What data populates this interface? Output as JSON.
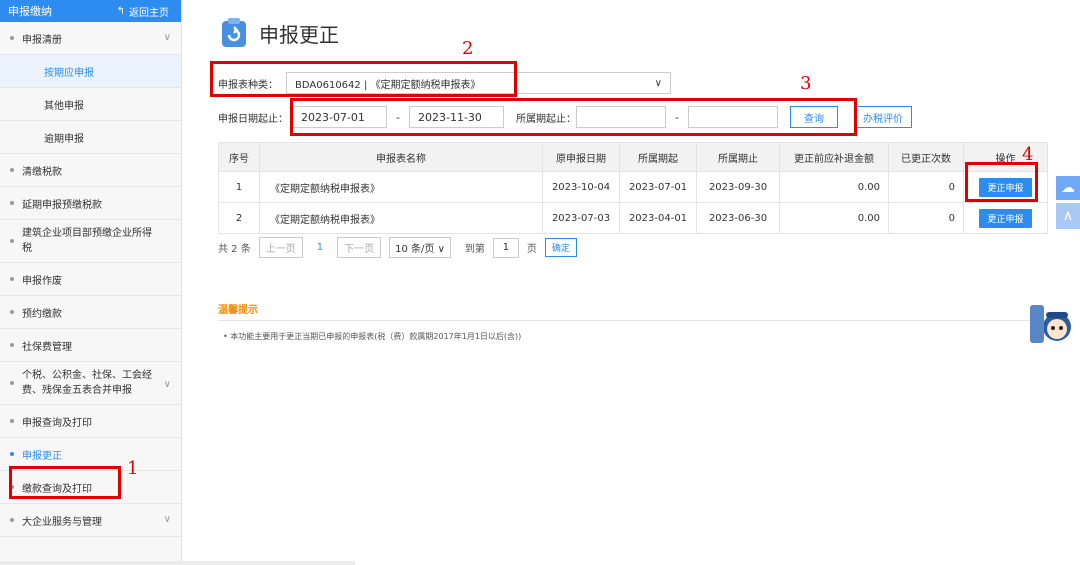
{
  "sidebar": {
    "header_title": "申报缴纳",
    "back_label": "返回主页",
    "items": [
      {
        "label": "申报清册"
      },
      {
        "label": "按期应申报"
      },
      {
        "label": "其他申报"
      },
      {
        "label": "逾期申报"
      },
      {
        "label": "清缴税款"
      },
      {
        "label": "延期申报预缴税款"
      },
      {
        "label": "建筑企业项目部预缴企业所得税"
      },
      {
        "label": "申报作废"
      },
      {
        "label": "预约缴款"
      },
      {
        "label": "社保费管理"
      },
      {
        "label": "个税、公积金、社保、工会经费、残保金五表合并申报"
      },
      {
        "label": "申报查询及打印"
      },
      {
        "label": "申报更正"
      },
      {
        "label": "缴款查询及打印"
      },
      {
        "label": "大企业服务与管理"
      }
    ]
  },
  "main": {
    "title": "申报更正",
    "form_type_label": "申报表种类：",
    "form_type_value": "BDA0610642 | 《定期定额纳税申报表》",
    "date_label": "申报日期起止：",
    "date_from": "2023-07-01",
    "date_to": "2023-11-30",
    "period_label": "所属期起止：",
    "period_from": "",
    "period_to": "",
    "dash": "-",
    "query_label": "查询",
    "evaluate_label": "办税评价"
  },
  "table": {
    "headers": [
      "序号",
      "申报表名称",
      "原申报日期",
      "所属期起",
      "所属期止",
      "更正前应补退金额",
      "已更正次数",
      "操作"
    ],
    "rows": [
      {
        "no": "1",
        "name": "《定期定额纳税申报表》",
        "orig_date": "2023-10-04",
        "start": "2023-07-01",
        "end": "2023-09-30",
        "amount": "0.00",
        "count": "0",
        "action": "更正申报"
      },
      {
        "no": "2",
        "name": "《定期定额纳税申报表》",
        "orig_date": "2023-07-03",
        "start": "2023-04-01",
        "end": "2023-06-30",
        "amount": "0.00",
        "count": "0",
        "action": "更正申报"
      }
    ]
  },
  "pager": {
    "total": "共 2 条",
    "prev": "上一页",
    "current": "1",
    "next": "下一页",
    "page_size": "10 条/页",
    "goto": "到第",
    "goto_value": "1",
    "page_unit": "页",
    "ok": "确定"
  },
  "tips": {
    "title": "温馨提示",
    "text": "本功能主要用于更正当期已申报的申报表(税（费）款属期2017年1月1日以后(含))"
  },
  "annotations": {
    "a1": "1",
    "a2": "2",
    "a3": "3",
    "a4": "4"
  },
  "colors": {
    "primary": "#2d8cf0",
    "annotation": "#e00000",
    "tip": "#f08c00"
  }
}
